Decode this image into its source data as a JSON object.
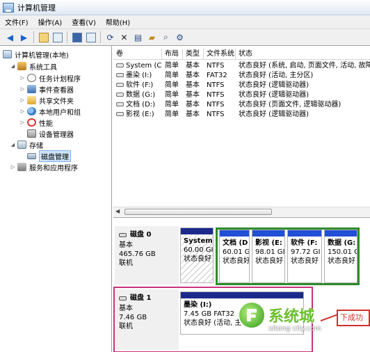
{
  "window": {
    "title": "计算机管理"
  },
  "menu": [
    "文件(F)",
    "操作(A)",
    "查看(V)",
    "帮助(H)"
  ],
  "toolbar": {
    "icons": [
      "back-arrow-icon",
      "forward-arrow-icon",
      "up-folder-icon",
      "show-hide-tree-icon",
      "help-icon",
      "console-icon",
      "refresh-icon",
      "delete-icon",
      "properties-icon",
      "open-icon",
      "search-icon",
      "settings-icon"
    ]
  },
  "tree": {
    "root": "计算机管理(本地)",
    "system_tools": "系统工具",
    "task_scheduler": "任务计划程序",
    "event_viewer": "事件查看器",
    "shared_folders": "共享文件夹",
    "local_users": "本地用户和组",
    "performance": "性能",
    "device_manager": "设备管理器",
    "storage": "存储",
    "disk_management": "磁盘管理",
    "services": "服务和应用程序"
  },
  "volumes": {
    "headers": [
      "卷",
      "布局",
      "类型",
      "文件系统",
      "状态"
    ],
    "rows": [
      {
        "name": "System (C:)",
        "layout": "简单",
        "type": "基本",
        "fs": "NTFS",
        "status": "状态良好 (系统, 启动, 页面文件, 活动, 故障"
      },
      {
        "name": "墨染 (I:)",
        "layout": "简单",
        "type": "基本",
        "fs": "FAT32",
        "status": "状态良好 (活动, 主分区)"
      },
      {
        "name": "软件 (F:)",
        "layout": "简单",
        "type": "基本",
        "fs": "NTFS",
        "status": "状态良好 (逻辑驱动器)"
      },
      {
        "name": "数据 (G:)",
        "layout": "简单",
        "type": "基本",
        "fs": "NTFS",
        "status": "状态良好 (逻辑驱动器)"
      },
      {
        "name": "文档 (D:)",
        "layout": "简单",
        "type": "基本",
        "fs": "NTFS",
        "status": "状态良好 (页面文件, 逻辑驱动器)"
      },
      {
        "name": "影视 (E:)",
        "layout": "简单",
        "type": "基本",
        "fs": "NTFS",
        "status": "状态良好 (逻辑驱动器)"
      }
    ]
  },
  "disks": [
    {
      "name": "磁盘 0",
      "kind": "基本",
      "size": "465.76 GB",
      "state": "联机",
      "partitions": [
        {
          "name": "System",
          "size": "60.00 GI",
          "status": "状态良好"
        },
        {
          "name": "文档 (D",
          "size": "60.01 G",
          "status": "状态良好"
        },
        {
          "name": "影视 (E:",
          "size": "98.01 GI",
          "status": "状态良好"
        },
        {
          "name": "软件 (F:",
          "size": "97.72 GI",
          "status": "状态良好"
        },
        {
          "name": "数据 (G:",
          "size": "150.01 G",
          "status": "状态良好"
        }
      ]
    },
    {
      "name": "磁盘 1",
      "kind": "基本",
      "size": "7.46 GB",
      "state": "联机",
      "partitions": [
        {
          "name": "墨染 (I:)",
          "size": "7.45 GB FAT32",
          "status": "状态良好 (活动, 主分区)"
        }
      ]
    }
  ],
  "watermark": {
    "brand": "系统城",
    "url": "xitong city.com",
    "tag": "下成功"
  },
  "colors": {
    "primary_partition_bar": "#1c2a8c",
    "logical_partition_bar": "#2050d6",
    "highlight_green": "#2d8c2a",
    "highlight_pink": "#c8337a"
  }
}
